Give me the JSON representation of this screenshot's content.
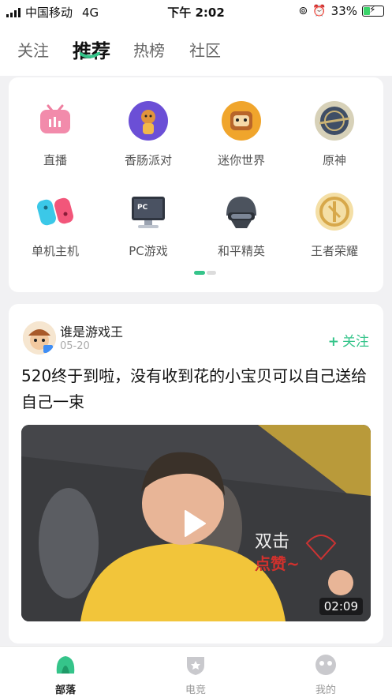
{
  "status": {
    "carrier": "中国移动",
    "network": "4G",
    "time": "下午 2:02",
    "battery": "33%"
  },
  "topnav": {
    "tabs": [
      {
        "label": "关注"
      },
      {
        "label": "推荐",
        "active": true
      },
      {
        "label": "热榜"
      },
      {
        "label": "社区"
      }
    ]
  },
  "categories": [
    {
      "label": "直播",
      "icon": "tv-live-icon"
    },
    {
      "label": "香肠派对",
      "icon": "sausage-party-icon"
    },
    {
      "label": "迷你世界",
      "icon": "mini-world-icon"
    },
    {
      "label": "原神",
      "icon": "genshin-icon"
    },
    {
      "label": "单机主机",
      "icon": "switch-console-icon"
    },
    {
      "label": "PC游戏",
      "icon": "pc-monitor-icon"
    },
    {
      "label": "和平精英",
      "icon": "helmet-icon"
    },
    {
      "label": "王者荣耀",
      "icon": "honor-of-kings-icon"
    }
  ],
  "post": {
    "author": "谁是游戏王",
    "date": "05-20",
    "follow_label": "关注",
    "text": "520终于到啦，没有收到花的小宝贝可以自己送给自己一束",
    "duration": "02:09",
    "overlay_line1": "双击",
    "overlay_line2": "点赞~"
  },
  "bottom_nav": [
    {
      "label": "部落",
      "active": true
    },
    {
      "label": "电竞"
    },
    {
      "label": "我的"
    }
  ],
  "colors": {
    "accent": "#35c48a",
    "background": "#f1f1f3"
  }
}
